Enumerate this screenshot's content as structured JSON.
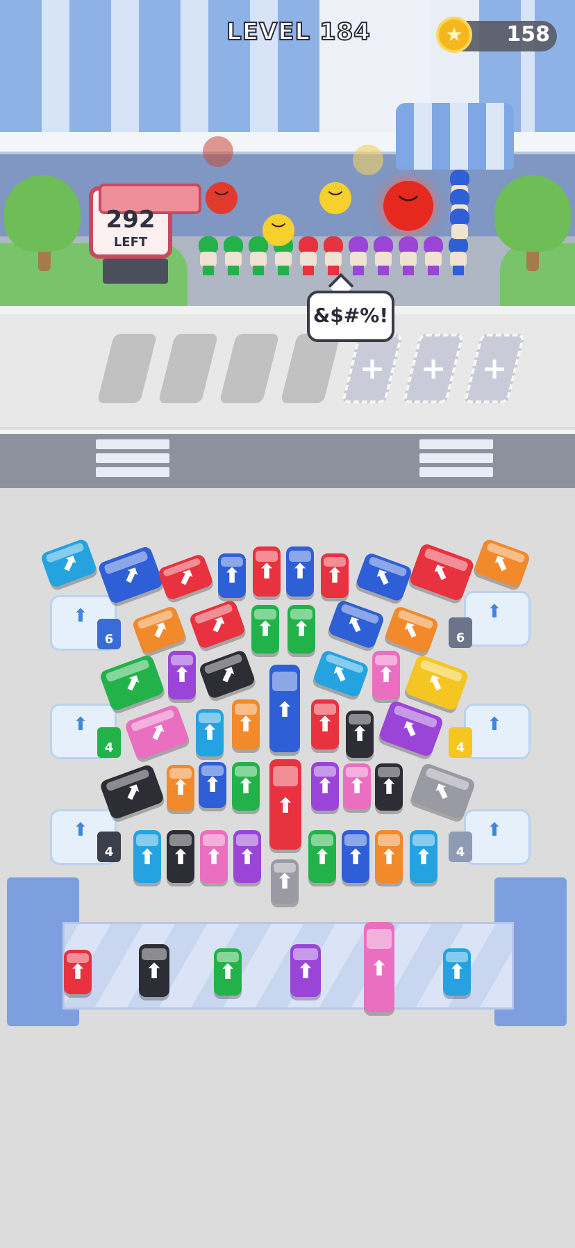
{
  "header": {
    "level_label": "LEVEL 184",
    "coins": "158",
    "coin_icon": "star-coin-icon"
  },
  "queue": {
    "remaining_count": "292",
    "remaining_label": "LEFT",
    "speech": "&$#%!"
  },
  "parking_slots": {
    "open_slots": 4,
    "locked_slots": 3,
    "locked_icon": "plus-icon"
  },
  "garages": {
    "left": [
      "6",
      "4",
      "4"
    ],
    "right": [
      "6",
      "4",
      "4"
    ]
  },
  "colors": {
    "red": "#e8323f",
    "blue": "#2f5fd6",
    "green": "#23b24a",
    "purple": "#9a45d8",
    "pink": "#ea6fc0",
    "orange": "#f2892a",
    "cyan": "#24a3e0",
    "yellow": "#f5c622",
    "black": "#2d2d36",
    "gray": "#9a9aa4"
  }
}
